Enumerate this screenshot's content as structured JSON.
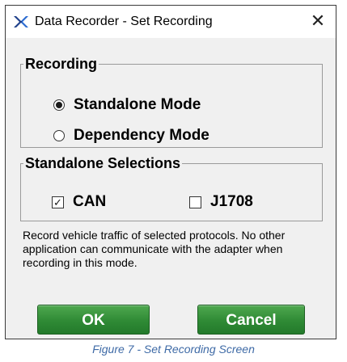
{
  "window": {
    "title": "Data Recorder - Set Recording",
    "app_icon": "dx-logo-icon",
    "close_glyph": "✕"
  },
  "recording_group": {
    "legend": "Recording",
    "options": [
      {
        "label": "Standalone Mode",
        "selected": true
      },
      {
        "label": "Dependency Mode",
        "selected": false
      }
    ]
  },
  "selections_group": {
    "legend": "Standalone Selections",
    "options": [
      {
        "label": "CAN",
        "checked": true,
        "check_glyph": "✓"
      },
      {
        "label": "J1708",
        "checked": false
      }
    ]
  },
  "description": "Record vehicle traffic of selected protocols. No other application can communicate with the adapter when recording in this mode.",
  "buttons": {
    "ok": "OK",
    "cancel": "Cancel"
  },
  "caption": "Figure 7 - Set Recording Screen",
  "colors": {
    "button_green": "#2f8a35",
    "caption_blue": "#3e6aa6",
    "dialog_bg": "#f0f0f0"
  }
}
